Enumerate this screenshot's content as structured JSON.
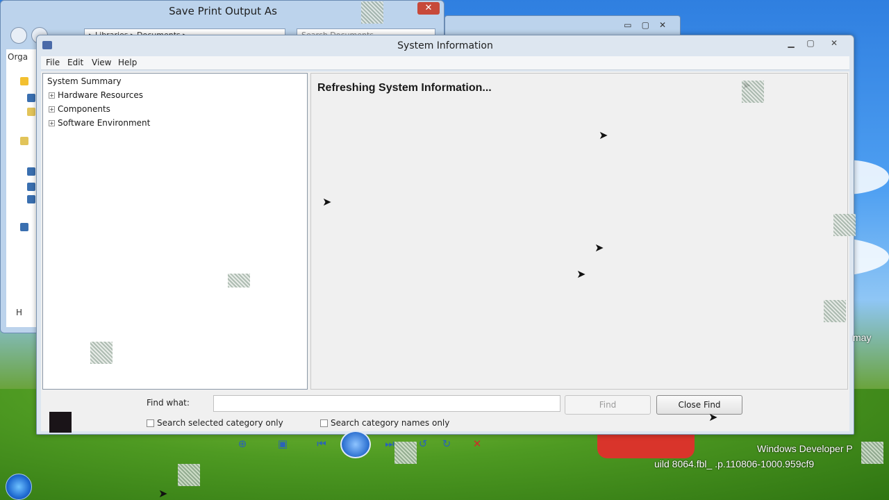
{
  "background_window": {
    "title": "Save Print Output As",
    "address": "▸ Libraries ▸ Documents ▸",
    "search_placeholder": "Search Documents",
    "organize_label": "Orga",
    "bottom_label": "H"
  },
  "main_window": {
    "title": "System Information",
    "menu": [
      "File",
      "Edit",
      "View",
      "Help"
    ],
    "tree": [
      {
        "label": "System Summary",
        "expandable": false
      },
      {
        "label": "Hardware Resources",
        "expandable": true
      },
      {
        "label": "Components",
        "expandable": true
      },
      {
        "label": "Software Environment",
        "expandable": true
      }
    ],
    "detail_status": "Refreshing System Information...",
    "find": {
      "label": "Find what:",
      "value": "",
      "find_button": "Find",
      "close_find_button": "Close Find",
      "search_selected_label": "Search selected category only",
      "search_names_label": "Search category names only"
    }
  },
  "desktop": {
    "watermark_line1": "Windows Developer P",
    "watermark_line2": "uild 8064.fbl_ .p.110806-1000.959cf9",
    "side_text": "may"
  },
  "colors": {
    "accent": "#2a63b8",
    "window_frame": "#dde6f0",
    "client_bg": "#f0f0f0"
  }
}
